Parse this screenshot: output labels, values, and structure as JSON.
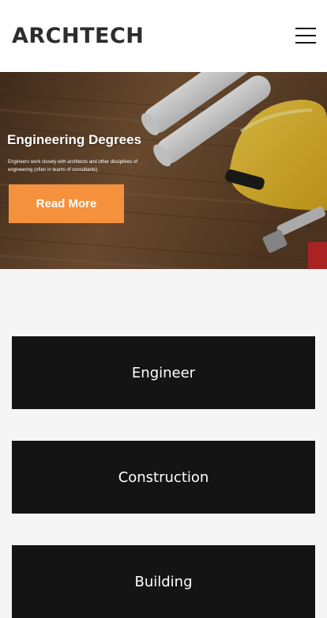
{
  "header": {
    "logo": "ARCHTECH"
  },
  "hero": {
    "title": "Engineering Degrees",
    "subtitle": "Engineers work closely with architects and other disciplines of engineering (often in teams of consultants)",
    "button_label": "Read More"
  },
  "services": [
    {
      "label": "Engineer"
    },
    {
      "label": "Construction"
    },
    {
      "label": "Building"
    }
  ],
  "colors": {
    "accent": "#f5913c",
    "card_background": "#141414",
    "page_background": "#f5f5f5"
  }
}
